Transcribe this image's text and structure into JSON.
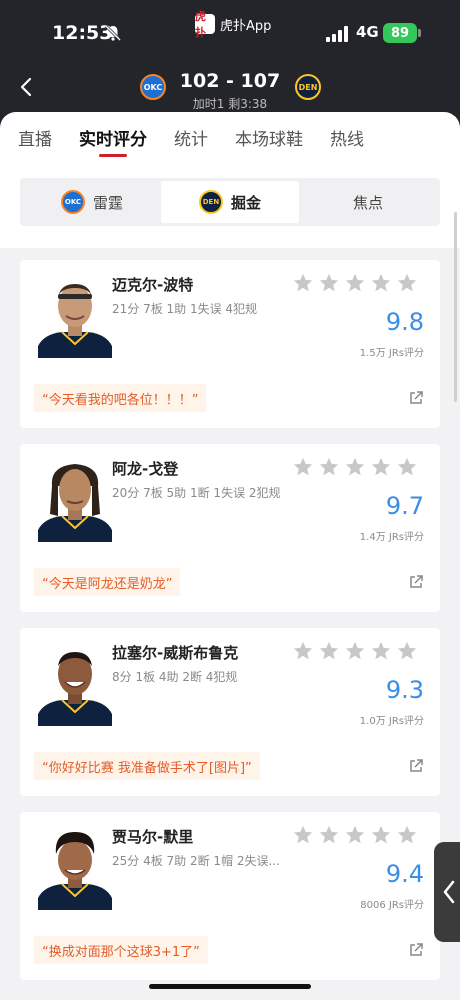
{
  "status_bar": {
    "time": "12:53",
    "app": "虎扑App",
    "app_logo": "虎扑",
    "network": "4G",
    "battery": "89"
  },
  "header": {
    "home_team_logo": "OKC",
    "away_team_logo": "DEN",
    "score": "102 - 107",
    "period": "加时1 剩3:38"
  },
  "tabs": [
    {
      "label": "直播"
    },
    {
      "label": "实时评分"
    },
    {
      "label": "统计"
    },
    {
      "label": "本场球鞋"
    },
    {
      "label": "热线"
    }
  ],
  "team_selector": {
    "options": [
      {
        "logo": "OKC",
        "label": "雷霆"
      },
      {
        "logo": "DEN",
        "label": "掘金"
      },
      {
        "label": "焦点"
      }
    ]
  },
  "players": [
    {
      "name": "迈克尔-波特",
      "stats": "21分 7板 1助 1失误 4犯规",
      "rating": "9.8",
      "count": "1.5万 JRs评分",
      "quote": "“今天看我的吧各位！！！”"
    },
    {
      "name": "阿龙-戈登",
      "stats": "20分 7板 5助 1断 1失误 2犯规",
      "rating": "9.7",
      "count": "1.4万 JRs评分",
      "quote": "“今天是阿龙还是奶龙”"
    },
    {
      "name": "拉塞尔-威斯布鲁克",
      "stats": "8分 1板 4助 2断 4犯规",
      "rating": "9.3",
      "count": "1.0万 JRs评分",
      "quote": "“你好好比赛 我准备做手术了[图片]”"
    },
    {
      "name": "贾马尔-默里",
      "stats": "25分 4板 7助 2断 1帽 2失误...",
      "rating": "9.4",
      "count": "8006 JRs评分",
      "quote": "“换成对面那个这球3+1了”"
    }
  ],
  "colors": {
    "accent": "#d01f2b",
    "rating": "#3a8ee6",
    "quote_text": "#e35c2a",
    "quote_bg": "#fff4ea"
  }
}
